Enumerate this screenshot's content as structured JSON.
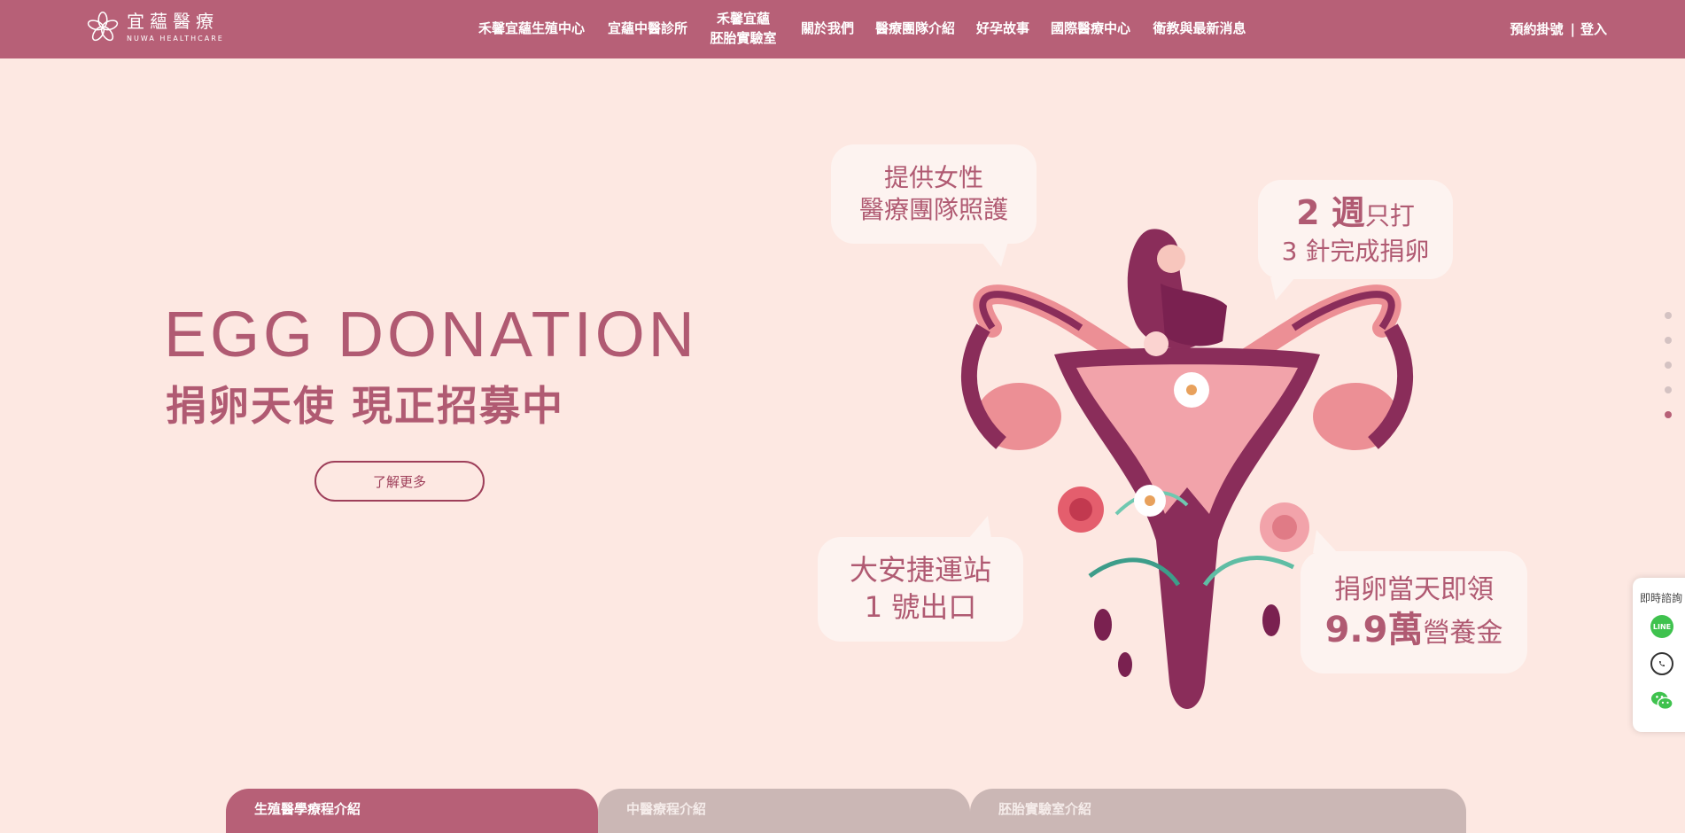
{
  "brand": {
    "name_cn": "宜蘊醫療",
    "name_en": "NUWA HEALTHCARE"
  },
  "nav": {
    "items": [
      {
        "label": "禾馨宜蘊生殖中心"
      },
      {
        "label": "宜蘊中醫診所"
      },
      {
        "line1": "禾馨宜蘊",
        "line2": "胚胎實驗室"
      },
      {
        "label": "關於我們"
      },
      {
        "label": "醫療團隊介紹"
      },
      {
        "label": "好孕故事"
      },
      {
        "label": "國際醫療中心"
      },
      {
        "label": "衛教與最新消息"
      }
    ],
    "booking": "預約掛號",
    "separator": "|",
    "login": "登入"
  },
  "hero": {
    "title": "EGG DONATION",
    "subtitle": "捐卵天使 現正招募中",
    "cta": "了解更多",
    "bubbles": {
      "b1": {
        "line1": "提供女性",
        "line2": "醫療團隊照護"
      },
      "b2": {
        "num": "2 週",
        "rest1": "只打",
        "line2": "3 針完成捐卵"
      },
      "b3": {
        "line1": "大安捷運站",
        "line2": "1 號出口"
      },
      "b4": {
        "line1": "捐卵當天即領",
        "big": "9.9萬",
        "rest": "營養金"
      }
    }
  },
  "pager": {
    "count": 5,
    "active_index": 4
  },
  "consult": {
    "label": "即時諮詢",
    "icons": [
      "line-icon",
      "whatsapp-icon",
      "wechat-icon"
    ],
    "line_text": "LINE"
  },
  "tabs": [
    {
      "label": "生殖醫學療程介紹",
      "active": true
    },
    {
      "label": "中醫療程介紹",
      "active": false
    },
    {
      "label": "胚胎實驗室介紹",
      "active": false
    }
  ],
  "colors": {
    "primary": "#b76077",
    "background": "#fde8e2",
    "text_accent": "#b05a72",
    "tab_inactive": "#cbb7b5"
  }
}
